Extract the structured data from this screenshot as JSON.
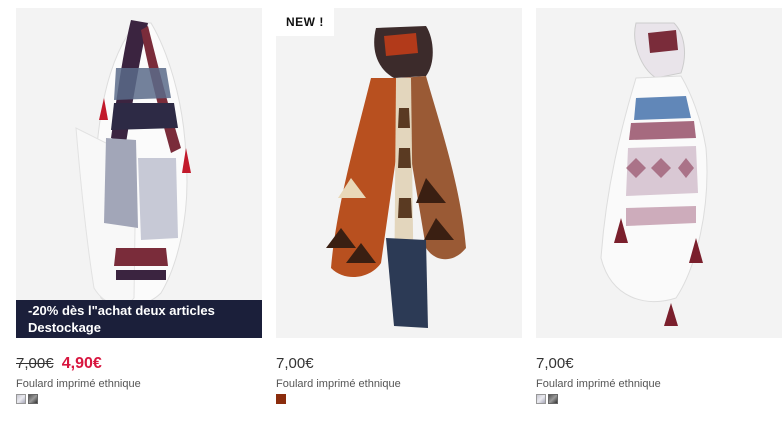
{
  "products": [
    {
      "promo_line1": "-20% dès l\"achat deux articles",
      "promo_line2": "Destockage",
      "old_price": "7,00€",
      "price": "4,90€",
      "name": "Foulard imprimé ethnique",
      "swatches": [
        "grey-multicolor",
        "dark-multicolor"
      ]
    },
    {
      "badge": "NEW !",
      "price": "7,00€",
      "name": "Foulard imprimé ethnique",
      "swatches": [
        "rust-brown"
      ]
    },
    {
      "price": "7,00€",
      "name": "Foulard imprimé ethnique",
      "swatches": [
        "grey-multicolor",
        "dark-multicolor"
      ]
    }
  ],
  "colors": {
    "promo_background": "#1b1f3a",
    "sale_price": "#d8163f",
    "swatch_brown": "#8b2c0d"
  }
}
